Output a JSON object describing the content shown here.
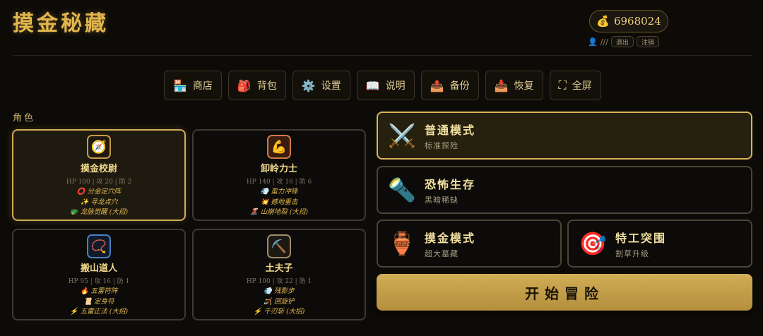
{
  "header": {
    "title": "摸金秘藏",
    "coins": "6968024",
    "user": "///",
    "logout_label": "退出",
    "deregister_label": "注销"
  },
  "toolbar": [
    {
      "icon": "🏪",
      "label": "商店"
    },
    {
      "icon": "🎒",
      "label": "背包"
    },
    {
      "icon": "⚙️",
      "label": "设置"
    },
    {
      "icon": "📖",
      "label": "说明"
    },
    {
      "icon": "📤",
      "label": "备份"
    },
    {
      "icon": "📥",
      "label": "恢复"
    },
    {
      "icon": "⛶",
      "label": "全屏"
    }
  ],
  "roles_label": "角色",
  "characters": [
    {
      "name": "摸金校尉",
      "avatar": "🧭",
      "stats": "HP 100 | 攻 20 | 防 2",
      "skills": [
        "⭕ 分金定穴阵",
        "✨ 寻龙点穴",
        "🐲 龙脉觉醒 (大招)"
      ],
      "selected": true,
      "avatar_color": "#c79b4a"
    },
    {
      "name": "卸岭力士",
      "avatar": "💪",
      "stats": "HP 140 | 攻 16 | 防 6",
      "skills": [
        "💨 蛮力冲锋",
        "💥 撼地重击",
        "🌋 山崩地裂 (大招)"
      ],
      "selected": false,
      "avatar_color": "#d07a45"
    },
    {
      "name": "搬山道人",
      "avatar": "📿",
      "stats": "HP 95 | 攻 16 | 防 1",
      "skills": [
        "🔥 五雷符阵",
        "📜 定身符",
        "⚡ 五雷正法 (大招)"
      ],
      "selected": false,
      "avatar_color": "#4a7fc4"
    },
    {
      "name": "土夫子",
      "avatar": "⛏️",
      "stats": "HP 100 | 攻 22 | 防 1",
      "skills": [
        "💨 残影步",
        "🪃 回旋铲",
        "⚡ 千刃斩 (大招)"
      ],
      "selected": false,
      "avatar_color": "#a08a6a"
    }
  ],
  "modes": {
    "normal": {
      "icon": "⚔️",
      "title": "普通模式",
      "desc": "标准探险"
    },
    "horror": {
      "icon": "🔦",
      "title": "恐怖生存",
      "desc": "黑暗稀缺"
    },
    "mojin": {
      "icon": "🏺",
      "title": "摸金模式",
      "desc": "超大墓藏"
    },
    "agent": {
      "icon": "🎯",
      "title": "特工突围",
      "desc": "割草升级"
    }
  },
  "start_label": "开始冒险"
}
